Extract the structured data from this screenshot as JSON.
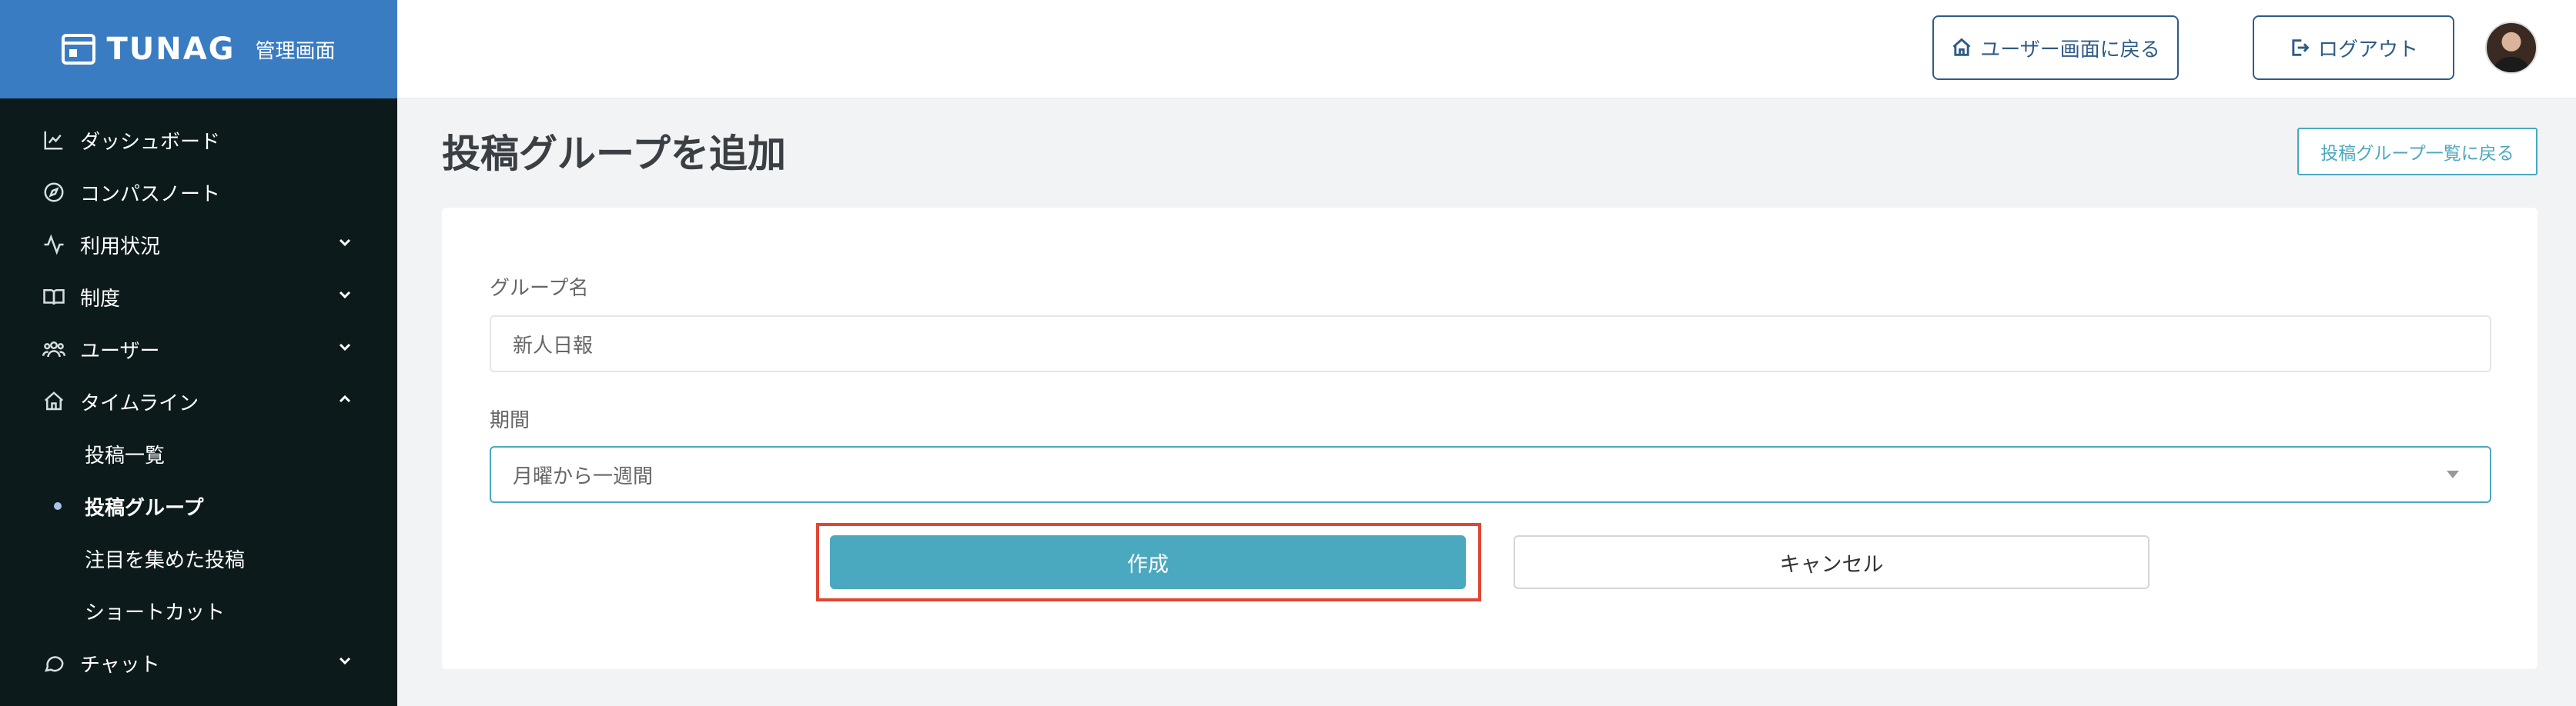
{
  "brand": {
    "name": "TUNAG",
    "subtitle": "管理画面"
  },
  "sidebar": {
    "items": [
      {
        "label": "ダッシュボード",
        "icon": "chart-line-icon"
      },
      {
        "label": "コンパスノート",
        "icon": "compass-icon"
      },
      {
        "label": "利用状況",
        "icon": "activity-icon",
        "expandable": true
      },
      {
        "label": "制度",
        "icon": "book-icon",
        "expandable": true
      },
      {
        "label": "ユーザー",
        "icon": "users-icon",
        "expandable": true
      },
      {
        "label": "タイムライン",
        "icon": "home-icon",
        "expanded": true
      },
      {
        "label": "チャット",
        "icon": "chat-bubble-icon",
        "expandable": true
      }
    ],
    "timeline_sub": [
      {
        "label": "投稿一覧"
      },
      {
        "label": "投稿グループ",
        "active": true
      },
      {
        "label": "注目を集めた投稿"
      },
      {
        "label": "ショートカット"
      }
    ]
  },
  "topbar": {
    "user_screen_label": "ユーザー画面に戻る",
    "logout_label": "ログアウト"
  },
  "page": {
    "title": "投稿グループを追加",
    "back_to_list_label": "投稿グループ一覧に戻る"
  },
  "form": {
    "group_name_label": "グループ名",
    "group_name_value": "新人日報",
    "period_label": "期間",
    "period_value": "月曜から一週間",
    "create_label": "作成",
    "cancel_label": "キャンセル"
  },
  "colors": {
    "brand_blue": "#3a7cc2",
    "sidebar_bg": "#0d1a1b",
    "accent_teal": "#4aa8bf",
    "highlight_red": "#e14534"
  }
}
